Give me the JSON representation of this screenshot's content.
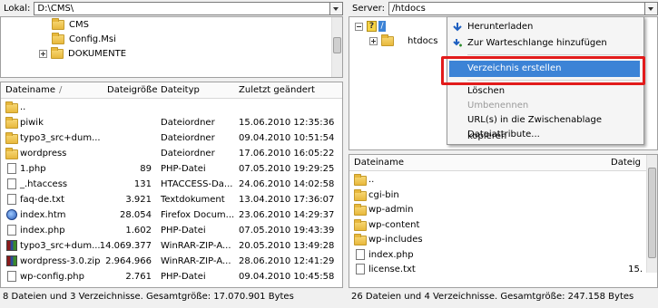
{
  "local": {
    "label": "Lokal:",
    "path": "D:\\CMS\\",
    "tree": [
      "CMS",
      "Config.Msi",
      "DOKUMENTE"
    ],
    "columns": [
      "Dateiname",
      "/",
      "Dateigröße",
      "Dateityp",
      "Zuletzt geändert"
    ],
    "rows": [
      {
        "icon": "folder",
        "name": "..",
        "size": "",
        "type": "",
        "date": ""
      },
      {
        "icon": "folder",
        "name": "piwik",
        "size": "",
        "type": "Dateiordner",
        "date": "15.06.2010 12:35:36"
      },
      {
        "icon": "folder",
        "name": "typo3_src+dum...",
        "size": "",
        "type": "Dateiordner",
        "date": "09.04.2010 10:51:54"
      },
      {
        "icon": "folder",
        "name": "wordpress",
        "size": "",
        "type": "Dateiordner",
        "date": "17.06.2010 16:05:22"
      },
      {
        "icon": "file",
        "name": "1.php",
        "size": "89",
        "type": "PHP-Datei",
        "date": "07.05.2010 19:29:25"
      },
      {
        "icon": "file",
        "name": "_.htaccess",
        "size": "131",
        "type": "HTACCESS-Da...",
        "date": "24.06.2010 14:02:58"
      },
      {
        "icon": "file",
        "name": "faq-de.txt",
        "size": "3.921",
        "type": "Textdokument",
        "date": "13.04.2010 17:36:07"
      },
      {
        "icon": "htm",
        "name": "index.htm",
        "size": "28.054",
        "type": "Firefox Docum...",
        "date": "23.06.2010 14:29:37"
      },
      {
        "icon": "file",
        "name": "index.php",
        "size": "1.602",
        "type": "PHP-Datei",
        "date": "07.05.2010 19:43:39"
      },
      {
        "icon": "zip",
        "name": "typo3_src+dum...",
        "size": "14.069.377",
        "type": "WinRAR-ZIP-A...",
        "date": "20.05.2010 13:49:28"
      },
      {
        "icon": "zip",
        "name": "wordpress-3.0.zip",
        "size": "2.964.966",
        "type": "WinRAR-ZIP-A...",
        "date": "28.06.2010 12:41:29"
      },
      {
        "icon": "file",
        "name": "wp-config.php",
        "size": "2.761",
        "type": "PHP-Datei",
        "date": "09.04.2010 10:45:58"
      }
    ],
    "status": "8 Dateien und 3 Verzeichnisse. Gesamtgröße: 17.070.901 Bytes"
  },
  "server": {
    "label": "Server:",
    "path": "/htdocs",
    "tree_root": "/",
    "tree_child": "htdocs",
    "columns": [
      "Dateiname",
      "Dateig"
    ],
    "rows": [
      {
        "icon": "folder",
        "name": ".."
      },
      {
        "icon": "folder",
        "name": "cgi-bin"
      },
      {
        "icon": "folder",
        "name": "wp-admin"
      },
      {
        "icon": "folder",
        "name": "wp-content"
      },
      {
        "icon": "folder",
        "name": "wp-includes"
      },
      {
        "icon": "file",
        "name": "index.php"
      },
      {
        "icon": "file",
        "name": "license.txt",
        "size": "15."
      }
    ],
    "status": "26 Dateien und 4 Verzeichnisse. Gesamtgröße: 247.158 Bytes"
  },
  "context_menu": {
    "download": "Herunterladen",
    "queue": "Zur Warteschlange hinzufügen",
    "create_dir": "Verzeichnis erstellen",
    "delete": "Löschen",
    "rename": "Umbenennen",
    "copy_url": "URL(s) in die Zwischenablage kopieren",
    "attributes": "Dateiattribute...",
    "highlight_color": "#e21b1b",
    "selected_color": "#3c83d6"
  }
}
